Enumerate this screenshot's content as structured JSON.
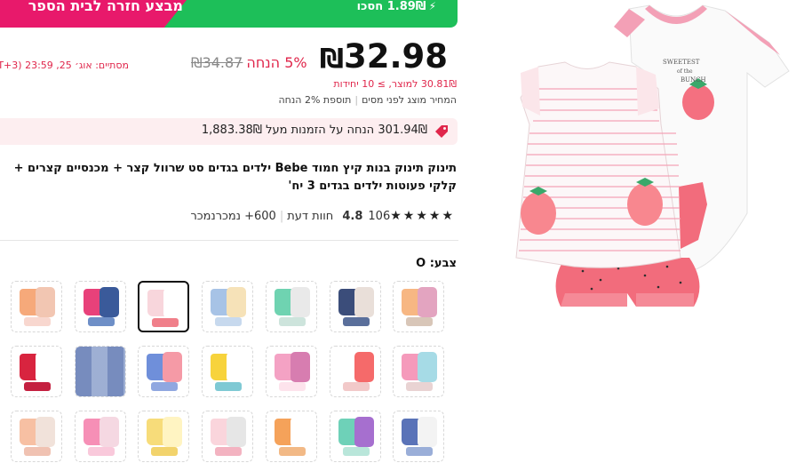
{
  "banner": {
    "title": "מבצע חזרה לבית הספר",
    "save": "1.89₪ חסכו"
  },
  "price": {
    "current": "32.98",
    "currency": "₪",
    "old": "₪34.87",
    "discount": "5% הנחה",
    "ends": "מסתיים: אוג׳ 25, 23:59 (GMT+3)",
    "unit": "30.81₪ למוצר, ≥ 10 יחידות",
    "before_tax": "המחיר מוצג לפני מסים",
    "extra": "תוספת 2% הנחה"
  },
  "coupon": {
    "text": "301.94₪ הנחה על הזמנות מעל 1,883.38₪"
  },
  "product": {
    "title": "תינוק תינוק בנות קיץ חמוד Bebe ילדים בגדים סט שרוול קצר + מכנסיים קצרים + קלקי פעוטות ילדים בגדים 3 יח'",
    "rating": "4.8",
    "reviews": "106 חוות דעת",
    "sold": "600+ נמכרנמכר"
  },
  "color": {
    "label": "צבע: O"
  },
  "swatches": [
    {
      "colors": [
        "#f6a97a",
        "#f2c6b2",
        "#f8d7cf"
      ]
    },
    {
      "colors": [
        "#e8417a",
        "#3a5a9a",
        "#6e8fc7"
      ]
    },
    {
      "colors": [
        "#f8d6dc",
        "#ffffff",
        "#f07f8a"
      ]
    },
    {
      "colors": [
        "#a7c3e6",
        "#f6e2b8",
        "#c7d9ee"
      ]
    },
    {
      "colors": [
        "#6fd3b1",
        "#e9e9e9",
        "#cde4dc"
      ]
    },
    {
      "colors": [
        "#3b4d7a",
        "#e9dfd9",
        "#5a6f9b"
      ]
    },
    {
      "colors": [
        "#f7b783",
        "#e3a4c0",
        "#d8c6b8"
      ]
    },
    {
      "colors": [
        "#d8243f",
        "#ffffff",
        "#c42040"
      ]
    },
    {
      "colors": [
        "#aebddc",
        "#dfe5f1",
        "#aebddc"
      ],
      "pattern": true
    },
    {
      "colors": [
        "#6f8fda",
        "#f59aa6",
        "#90a7e0"
      ]
    },
    {
      "colors": [
        "#f7d33c",
        "#ffffff",
        "#7fc9d4"
      ]
    },
    {
      "colors": [
        "#f4a2c4",
        "#d77db0",
        "#fde3ec"
      ]
    },
    {
      "colors": [
        "#ffffff",
        "#f56a6a",
        "#f2c9c9"
      ]
    },
    {
      "colors": [
        "#f59abb",
        "#a6dbe6",
        "#e9d3d3"
      ]
    },
    {
      "colors": [
        "#f7c0a3",
        "#f1e2da",
        "#f0c2b2"
      ]
    },
    {
      "colors": [
        "#f68fb6",
        "#f5d8e2",
        "#f9c9db"
      ]
    },
    {
      "colors": [
        "#f7dc7a",
        "#fff4c2",
        "#f2d36c"
      ]
    },
    {
      "colors": [
        "#fad5dc",
        "#e6e6e6",
        "#f3b3c1"
      ]
    },
    {
      "colors": [
        "#f5a25a",
        "#ffffff",
        "#f2b986"
      ]
    },
    {
      "colors": [
        "#6ed1b8",
        "#a66fcf",
        "#b9e6da"
      ]
    },
    {
      "colors": [
        "#5a73b8",
        "#f3f3f3",
        "#9aaed8"
      ]
    }
  ]
}
